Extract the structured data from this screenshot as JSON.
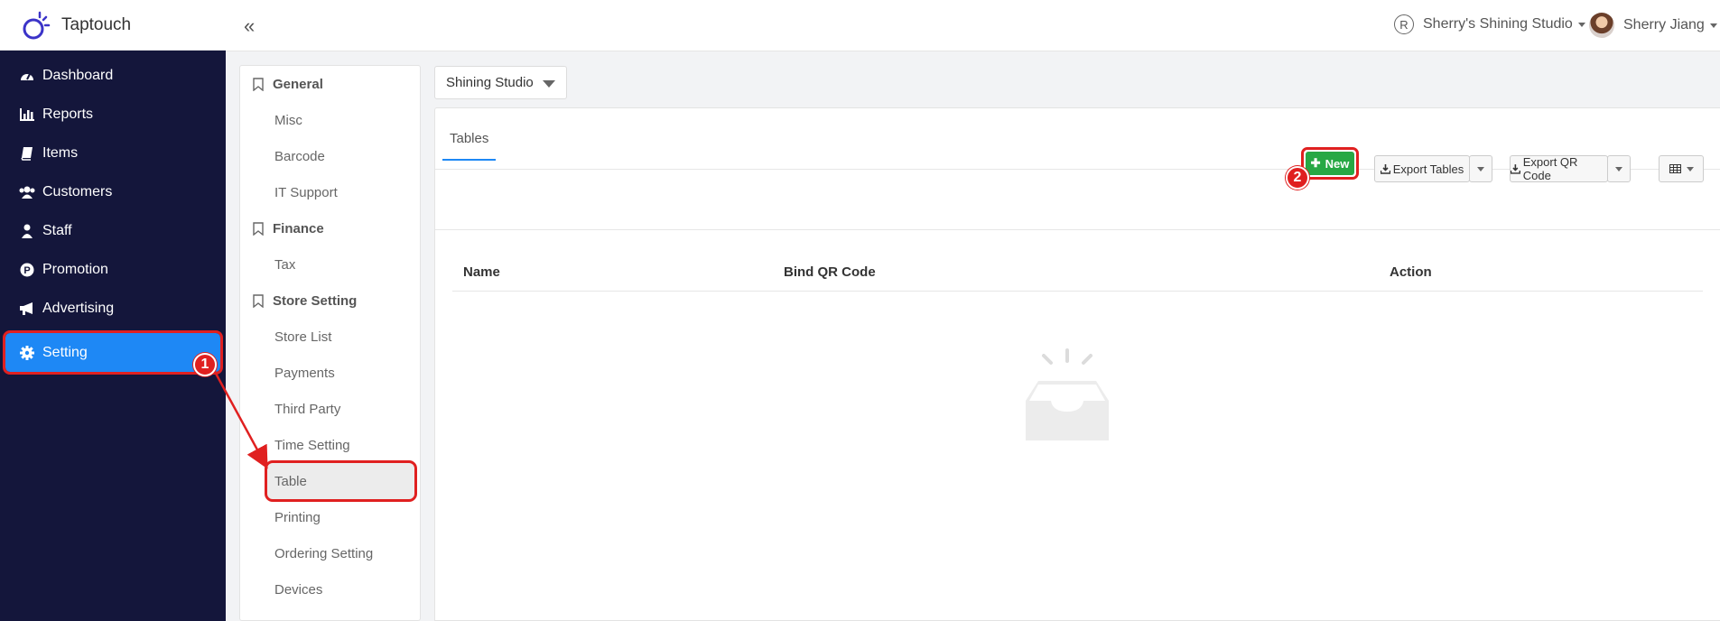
{
  "brand": {
    "name": "Taptouch"
  },
  "nav": [
    {
      "label": "Dashboard",
      "icon": "dashboard-icon"
    },
    {
      "label": "Reports",
      "icon": "bar-chart-icon"
    },
    {
      "label": "Items",
      "icon": "book-icon"
    },
    {
      "label": "Customers",
      "icon": "users-icon"
    },
    {
      "label": "Staff",
      "icon": "staff-icon"
    },
    {
      "label": "Promotion",
      "icon": "promotion-icon"
    },
    {
      "label": "Advertising",
      "icon": "megaphone-icon"
    },
    {
      "label": "Setting",
      "icon": "gear-icon",
      "active": true
    }
  ],
  "topbar": {
    "studio_badge": "R",
    "studio_name": "Sherry's Shining Studio",
    "user_name": "Sherry Jiang"
  },
  "submenu": {
    "general": {
      "title": "General",
      "items": [
        "Misc",
        "Barcode",
        "IT Support"
      ]
    },
    "finance": {
      "title": "Finance",
      "items": [
        "Tax"
      ]
    },
    "store": {
      "title": "Store Setting",
      "items": [
        "Store List",
        "Payments",
        "Third Party",
        "Time Setting",
        "Table",
        "Printing",
        "Ordering Setting",
        "Devices"
      ]
    }
  },
  "store_select": "Shining Studio",
  "tabs": [
    "Tables"
  ],
  "toolbar": {
    "new_label": "New",
    "export_tables": "Export Tables",
    "export_qr": "Export QR Code"
  },
  "table": {
    "columns": [
      "Name",
      "Bind QR Code",
      "Action"
    ]
  },
  "annotations": [
    "1",
    "2"
  ],
  "colors": {
    "sidebar": "#14163b",
    "accent": "#1e88f5",
    "new_button": "#27a844",
    "annotation": "#e02020"
  }
}
